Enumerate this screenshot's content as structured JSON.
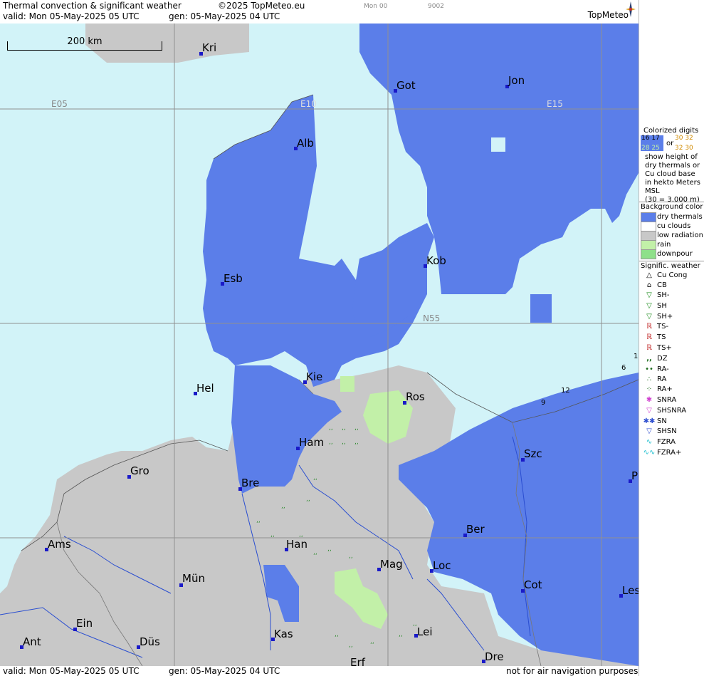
{
  "header": {
    "title": "Thermal convection & significant weather",
    "copyright": "©2025 TopMeteo.eu",
    "valid": "valid:  Mon  05-May-2025  05 UTC",
    "gen": "gen: 05-May-2025 04 UTC",
    "run_small": "Mon 00",
    "code_small": "9002",
    "logo": "TopMeteo"
  },
  "scale_label": "200 km",
  "grid_labels": {
    "e05": "E05",
    "e10": "E10",
    "e15": "E15",
    "n55": "N55"
  },
  "cities": {
    "kri": "Kri",
    "got": "Got",
    "jon": "Jon",
    "alb": "Alb",
    "esb": "Esb",
    "kob": "Kob",
    "kie": "Kie",
    "hel": "Hel",
    "ros": "Ros",
    "ham": "Ham",
    "gro": "Gro",
    "bre": "Bre",
    "szc": "Szc",
    "ams": "Ams",
    "han": "Han",
    "ber": "Ber",
    "mag": "Mag",
    "loc": "Loc",
    "mun": "Mün",
    "cot": "Cot",
    "les": "Les",
    "ein": "Ein",
    "kas": "Kas",
    "lei": "Lei",
    "ant": "Ant",
    "dus": "Düs",
    "dre": "Dre",
    "erf": "Erf",
    "p": "P"
  },
  "digits": {
    "d12": "12",
    "d9": "9",
    "d6": "6",
    "d1": "1"
  },
  "footer": {
    "valid": "valid:  Mon  05-May-2025  05 UTC",
    "gen": "gen: 05-May-2025 04 UTC",
    "note": "not for air navigation purposes"
  },
  "legend": {
    "colorized_title": "Colorized digits",
    "sample_a": "16 17",
    "sample_b": "28 25",
    "or": "or",
    "sample_c": "30 32",
    "sample_d": "32 30",
    "desc1": "show height of",
    "desc2": "dry thermals or",
    "desc3": "Cu cloud base",
    "desc4": "in hekto Meters",
    "desc5": "MSL",
    "desc6": "(30 = 3.000 m)",
    "bg_title": "Background color",
    "bg_items": [
      "dry thermals",
      "cu clouds",
      "low radiation",
      "rain",
      "downpour"
    ],
    "bg_colors": [
      "#5b7ee9",
      "#ffffff",
      "#c8c8c8",
      "#c2f0a8",
      "#8ee08a"
    ],
    "wx_title": "Signific. weather",
    "wx_items": [
      "Cu Cong",
      "CB",
      "SH-",
      "SH",
      "SH+",
      "TS-",
      "TS",
      "TS+",
      "DZ",
      "RA-",
      "RA",
      "RA+",
      "SNRA",
      "SHSNRA",
      "SN",
      "SHSN",
      "FZRA",
      "FZRA+"
    ]
  },
  "colors": {
    "sea": "#d2f3f8",
    "dry_thermals": "#5b7ee9",
    "low_radiation": "#c8c8c8",
    "rain": "#c2f0a8",
    "grid": "#909090",
    "city_dot": "#1a1ac8"
  }
}
